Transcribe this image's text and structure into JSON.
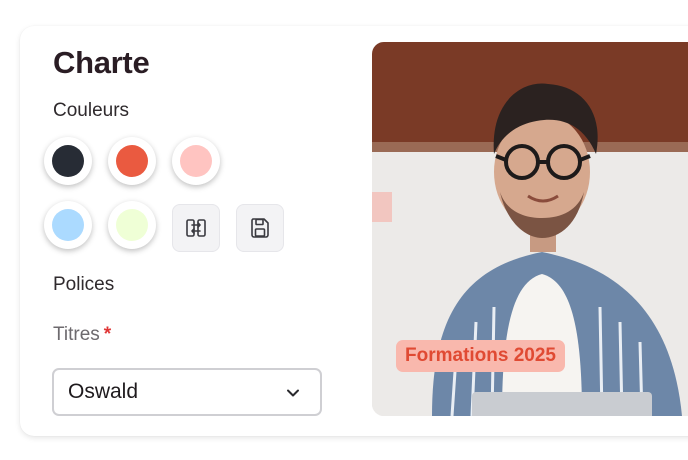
{
  "panel": {
    "title": "Charte",
    "colors_label": "Couleurs",
    "fonts_label": "Polices"
  },
  "swatches": [
    {
      "name": "dark",
      "color": "#272c35"
    },
    {
      "name": "red",
      "color": "#ea5a40"
    },
    {
      "name": "pink",
      "color": "#ffc4c1"
    },
    {
      "name": "light-blue",
      "color": "#abdaff"
    },
    {
      "name": "light-green",
      "color": "#efffd6"
    }
  ],
  "actions": {
    "swap_icon": "swap-icon",
    "save_icon": "save-icon"
  },
  "titles_field": {
    "label": "Titres",
    "required_mark": "*",
    "value": "Oswald"
  },
  "photo": {
    "badge": "Formations 2025"
  },
  "colors": {
    "accent": "#ea5a40",
    "badge_bg": "#f9b8ad",
    "text": "#2a1d24"
  }
}
